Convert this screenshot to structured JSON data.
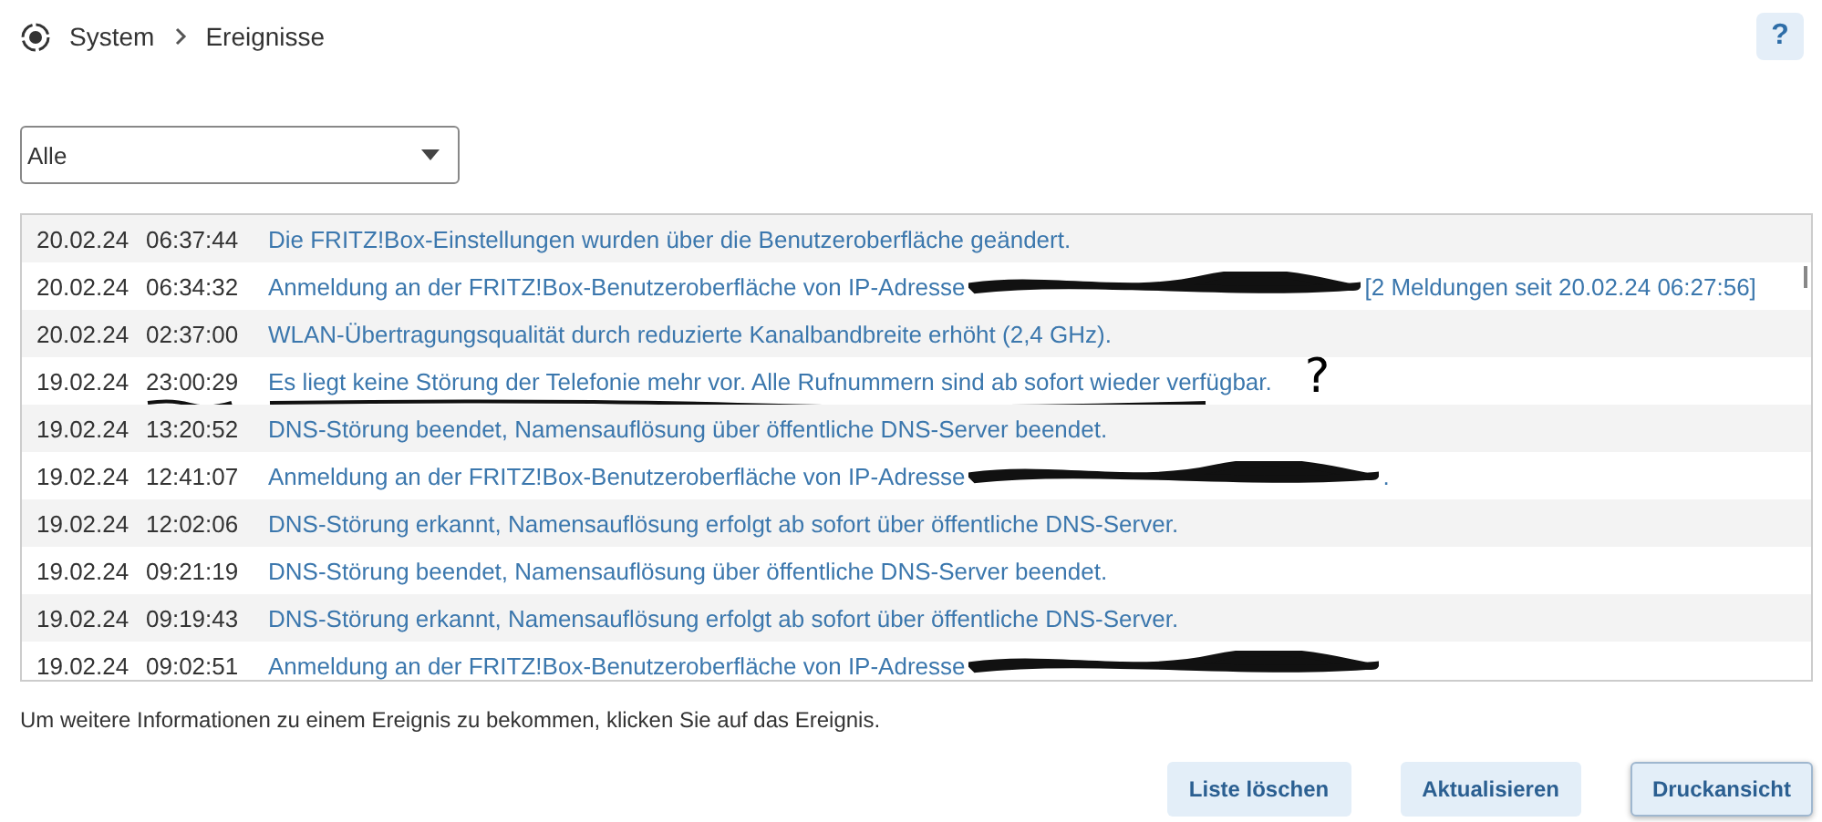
{
  "breadcrumb": [
    "System",
    "Ereignisse"
  ],
  "help_button": "?",
  "filter": {
    "value": "Alle"
  },
  "events": [
    {
      "date": "20.02.24",
      "time": "06:37:44",
      "message": "Die FRITZ!Box-Einstellungen wurden über die Benutzeroberfläche geändert."
    },
    {
      "date": "20.02.24",
      "time": "06:34:32",
      "message": "Anmeldung an der FRITZ!Box-Benutzeroberfläche von IP-Adresse",
      "redacted": true,
      "suffix": "[2 Meldungen seit 20.02.24 06:27:56]"
    },
    {
      "date": "20.02.24",
      "time": "02:37:00",
      "message": "WLAN-Übertragungsqualität durch reduzierte Kanalbandbreite erhöht (2,4 GHz)."
    },
    {
      "date": "19.02.24",
      "time": "23:00:29",
      "message": "Es liegt keine Störung der Telefonie mehr vor. Alle Rufnummern sind ab sofort wieder verfügbar.",
      "underlined": true,
      "note": "?"
    },
    {
      "date": "19.02.24",
      "time": "13:20:52",
      "message": "DNS-Störung beendet, Namensauflösung über öffentliche DNS-Server beendet."
    },
    {
      "date": "19.02.24",
      "time": "12:41:07",
      "message": "Anmeldung an der FRITZ!Box-Benutzeroberfläche von IP-Adresse",
      "redacted": true,
      "suffix": "."
    },
    {
      "date": "19.02.24",
      "time": "12:02:06",
      "message": "DNS-Störung erkannt, Namensauflösung erfolgt ab sofort über öffentliche DNS-Server."
    },
    {
      "date": "19.02.24",
      "time": "09:21:19",
      "message": "DNS-Störung beendet, Namensauflösung über öffentliche DNS-Server beendet."
    },
    {
      "date": "19.02.24",
      "time": "09:19:43",
      "message": "DNS-Störung erkannt, Namensauflösung erfolgt ab sofort über öffentliche DNS-Server."
    },
    {
      "date": "19.02.24",
      "time": "09:02:51",
      "message": "Anmeldung an der FRITZ!Box-Benutzeroberfläche von IP-Adresse",
      "redacted": true
    }
  ],
  "info": "Um weitere Informationen zu einem Ereignis zu bekommen, klicken Sie auf das Ereignis.",
  "buttons": [
    {
      "label": "Liste löschen",
      "focused": false
    },
    {
      "label": "Aktualisieren",
      "focused": false
    },
    {
      "label": "Druckansicht",
      "focused": true
    }
  ]
}
